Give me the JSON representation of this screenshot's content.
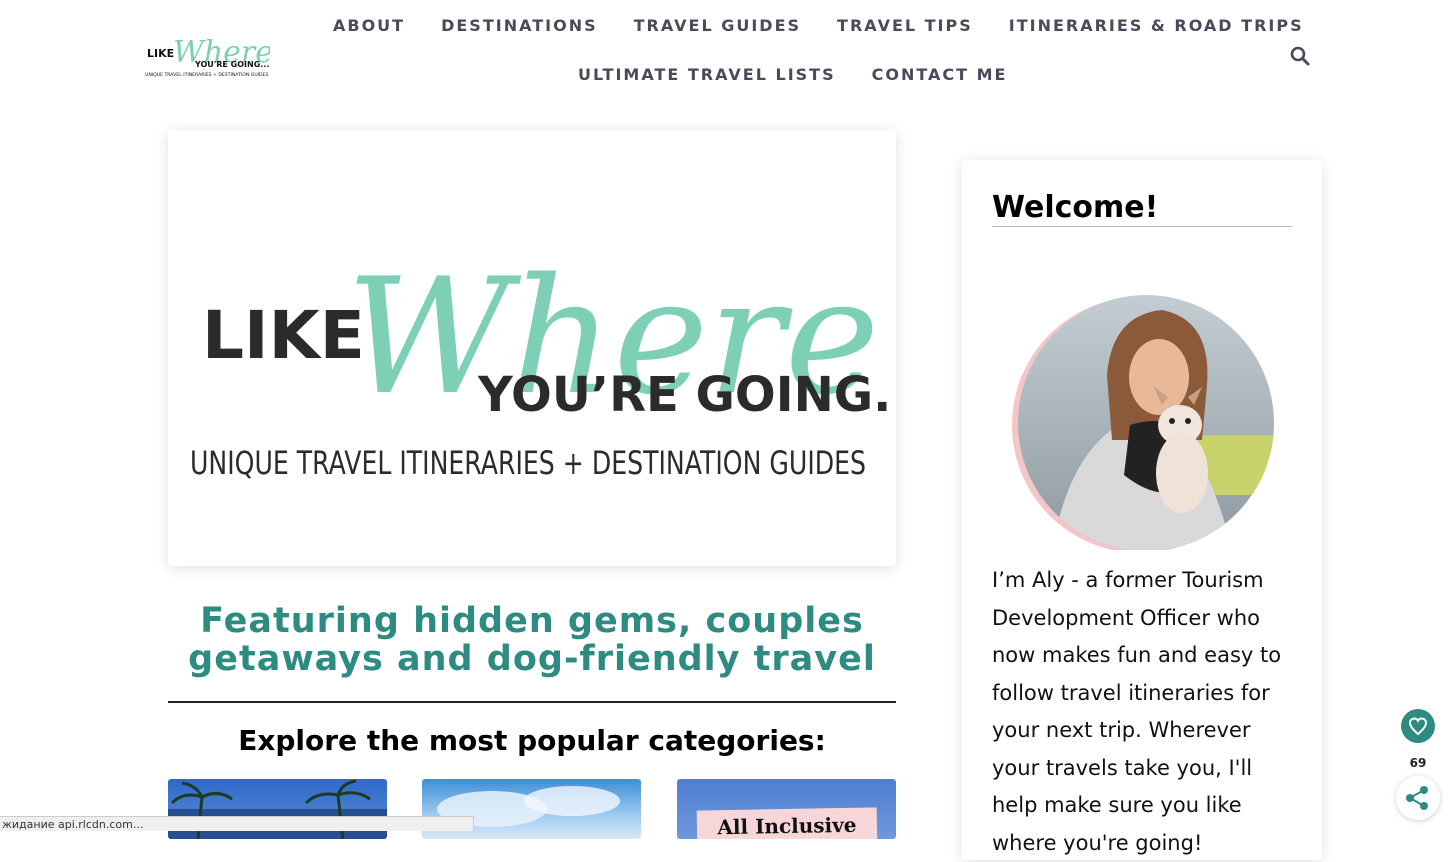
{
  "logo": {
    "like": "LIKE",
    "where": "Where",
    "going": "YOU'RE GOING...",
    "tagline": "UNIQUE TRAVEL ITINERARIES + DESTINATION GUIDES"
  },
  "nav": {
    "row1": [
      "ABOUT",
      "DESTINATIONS",
      "TRAVEL GUIDES",
      "TRAVEL TIPS",
      "ITINERARIES & ROAD TRIPS"
    ],
    "row2": [
      "ULTIMATE TRAVEL LISTS",
      "CONTACT ME"
    ]
  },
  "hero": {
    "like": "LIKE",
    "where": "Where",
    "going": "YOU’RE GOING...",
    "subtitle": "UNIQUE TRAVEL ITINERARIES + DESTINATION GUIDES"
  },
  "tagline": {
    "line1": "Featuring hidden gems, couples",
    "line2": "getaways and dog-friendly travel"
  },
  "explore": "Explore the most popular categories:",
  "categories": {
    "third_label": "All Inclusive"
  },
  "sidebar": {
    "title": "Welcome!",
    "bio": "I’m Aly - a former Tourism Development Officer who now makes fun and easy to follow travel itineraries for your next trip. Wherever your travels take you, I'll help make sure you like where you're going!"
  },
  "share": {
    "count": "69"
  },
  "statusbar": {
    "text": "жидание api.rlcdn.com..."
  },
  "colors": {
    "brand_teal": "#2e8b82",
    "logo_mint": "#7dcfb6",
    "nav_text": "#4a4a5a"
  }
}
